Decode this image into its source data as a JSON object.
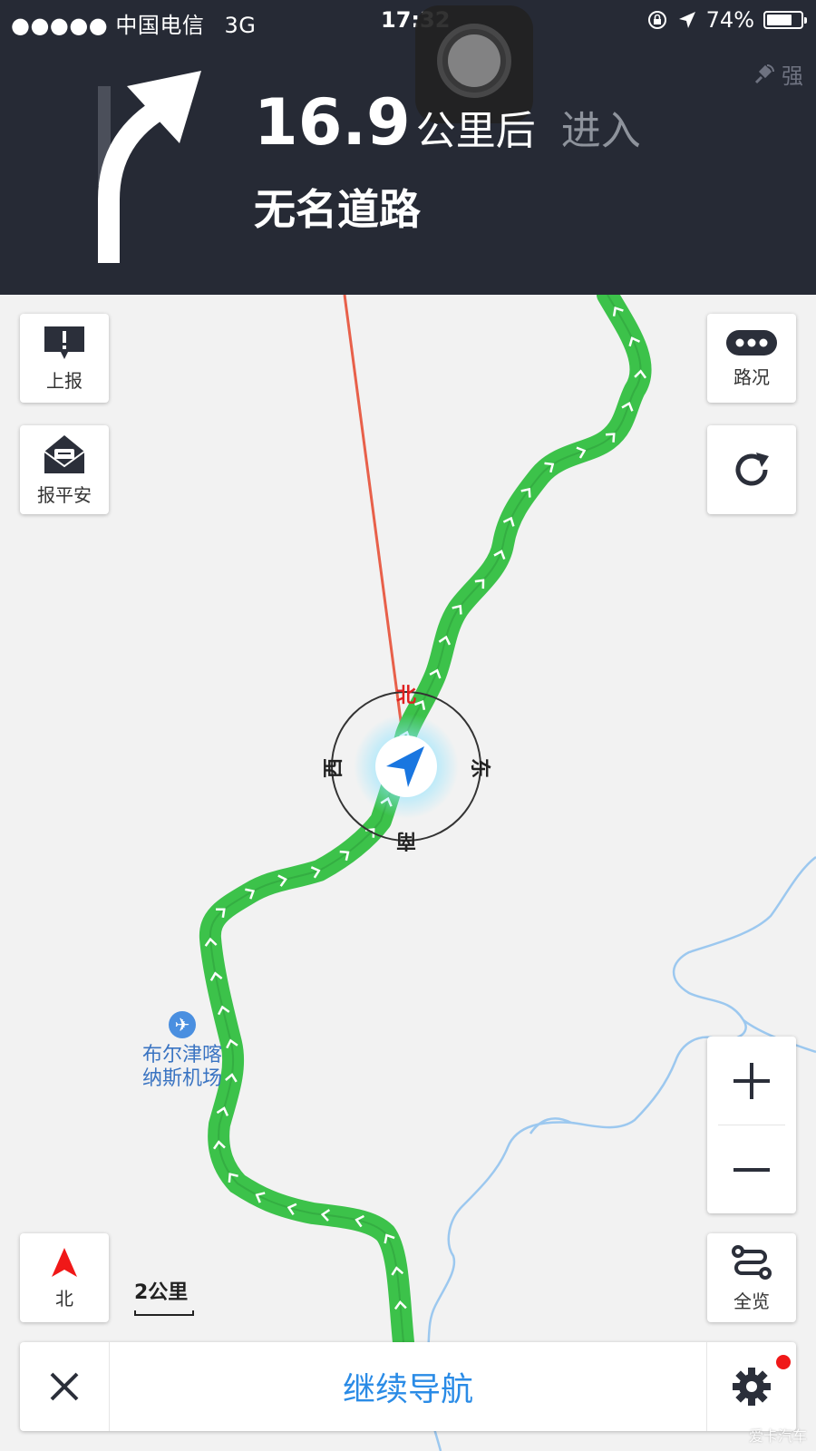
{
  "status_bar": {
    "signal_dots": "●●●●●",
    "carrier": "中国电信",
    "network": "3G",
    "time": "17:32",
    "battery_percent": "74%",
    "battery_level": 0.74,
    "icons": [
      "rotation-lock-icon",
      "location-arrow-icon",
      "battery-icon"
    ]
  },
  "gps": {
    "strength_label": "强",
    "icon": "satellite-icon"
  },
  "guidance": {
    "maneuver_icon": "turn-right-arrow-icon",
    "distance_value": "16.9",
    "distance_unit": "公里后",
    "action": "进入",
    "road_name": "无名道路"
  },
  "map": {
    "compass": {
      "north": "北",
      "south": "南",
      "east": "东",
      "west": "西"
    },
    "poi": {
      "name_line1": "布尔津喀",
      "name_line2": "纳斯机场",
      "icon": "airport-icon"
    },
    "scale_label": "2公里",
    "route_color": "#3cc24a",
    "river_color": "#9cc8ef",
    "heading_line_color": "#e8604a"
  },
  "buttons": {
    "report": {
      "label": "上报",
      "icon": "exclamation-bubble-icon"
    },
    "safe": {
      "label": "报平安",
      "icon": "envelope-icon"
    },
    "traffic": {
      "label": "路况",
      "icon": "traffic-dots-icon"
    },
    "refresh": {
      "icon": "refresh-icon"
    },
    "zoom_in": {
      "icon": "plus-icon"
    },
    "zoom_out": {
      "icon": "minus-icon"
    },
    "north": {
      "label": "北",
      "icon": "north-arrow-icon"
    },
    "overview": {
      "label": "全览",
      "icon": "route-overview-icon"
    }
  },
  "bottom_bar": {
    "close_icon": "close-icon",
    "continue_label": "继续导航",
    "settings_icon": "gear-icon",
    "accent_color": "#2a8be6"
  },
  "watermark": "爱卡汽车"
}
